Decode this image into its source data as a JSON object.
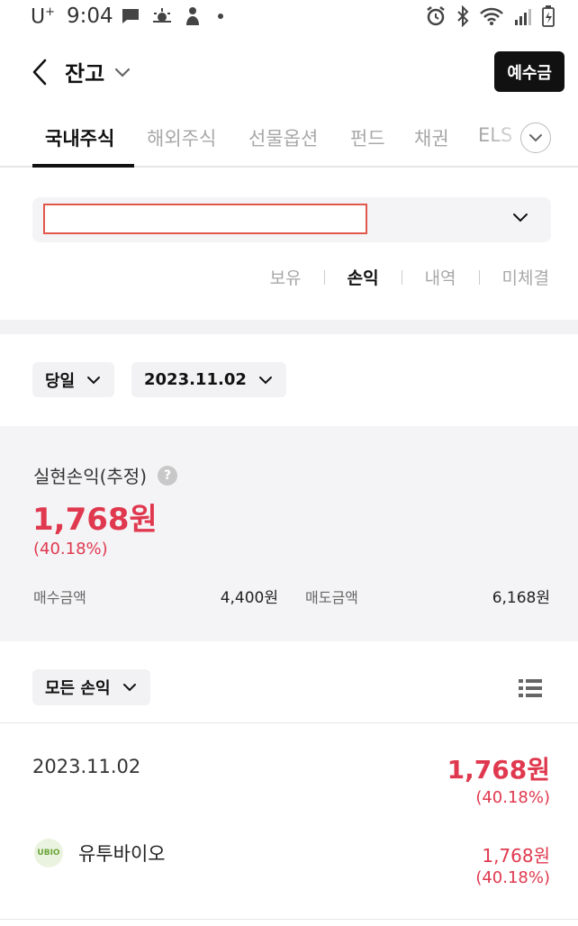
{
  "status_bar": {
    "carrier": "U",
    "carrier_sup": "+",
    "time": "9:04"
  },
  "header": {
    "title": "잔고",
    "deposit_button": "예수금"
  },
  "tabs": [
    {
      "label": "국내주식",
      "active": true
    },
    {
      "label": "해외주식",
      "active": false
    },
    {
      "label": "선물옵션",
      "active": false
    },
    {
      "label": "펀드",
      "active": false
    },
    {
      "label": "채권",
      "active": false
    },
    {
      "label": "ELS",
      "active": false
    }
  ],
  "account": {
    "value": ""
  },
  "subtabs": [
    {
      "label": "보유",
      "active": false
    },
    {
      "label": "손익",
      "active": true
    },
    {
      "label": "내역",
      "active": false
    },
    {
      "label": "미체결",
      "active": false
    }
  ],
  "filters": {
    "period": "당일",
    "date": "2023.11.02"
  },
  "summary": {
    "label": "실현손익(추정)",
    "help": "?",
    "value": "1,768원",
    "rate": "(40.18%)",
    "buy_label": "매수금액",
    "buy_value": "4,400원",
    "sell_label": "매도금액",
    "sell_value": "6,168원"
  },
  "list": {
    "filter": "모든 손익",
    "rows": [
      {
        "date": "2023.11.02",
        "total": "1,768원",
        "total_rate": "(40.18%)",
        "stocks": [
          {
            "logo_text": "UBIO",
            "name": "유투바이오",
            "amount": "1,768원",
            "rate": "(40.18%)"
          }
        ]
      }
    ]
  },
  "colors": {
    "profit": "#e0394f",
    "accent_dark": "#111111",
    "highlight_border": "#e2574c"
  },
  "icons": [
    "back-chevron-icon",
    "chevron-down-icon",
    "help-icon",
    "list-view-icon",
    "alarm-icon",
    "bluetooth-icon",
    "wifi-icon",
    "signal-icon",
    "battery-icon",
    "chat-icon",
    "weather-icon",
    "person-icon"
  ]
}
